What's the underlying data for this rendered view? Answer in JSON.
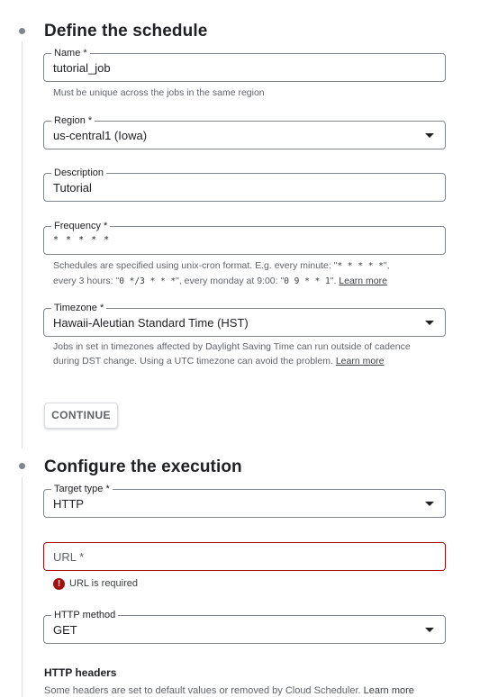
{
  "schedule": {
    "title": "Define the schedule",
    "name": {
      "label": "Name *",
      "value": "tutorial_job",
      "hint": "Must be unique across the jobs in the same region"
    },
    "region": {
      "label": "Region *",
      "value": "us-central1 (Iowa)"
    },
    "description": {
      "label": "Description",
      "value": "Tutorial"
    },
    "frequency": {
      "label": "Frequency *",
      "value": "* * * * *",
      "hint_1": "Schedules are specified using unix-cron format. E.g. every minute: \"",
      "hint_code_1": "* * * * *",
      "hint_2": "\",",
      "hint_3": "every 3 hours: \"",
      "hint_code_2": "0 */3 * * *",
      "hint_4": "\", every monday at 9:00: \"",
      "hint_code_3": "0 9 * * 1",
      "hint_5": "\". ",
      "learn_more": "Learn more"
    },
    "timezone": {
      "label": "Timezone *",
      "value": "Hawaii-Aleutian Standard Time (HST)",
      "hint": "Jobs in set in timezones affected by Daylight Saving Time can run outside of cadence during DST change. Using a UTC timezone can avoid the problem. ",
      "learn_more": "Learn more"
    },
    "continue_label": "CONTINUE"
  },
  "execution": {
    "title": "Configure the execution",
    "target_type": {
      "label": "Target type *",
      "value": "HTTP"
    },
    "url": {
      "placeholder": "URL *",
      "error": "URL is required",
      "error_icon": "!"
    },
    "http_method": {
      "label": "HTTP method",
      "value": "GET"
    },
    "headers": {
      "title": "HTTP headers",
      "hint": "Some headers are set to default values or removed by Cloud Scheduler. ",
      "learn_more": "Learn more"
    }
  },
  "colors": {
    "error": "#a50e0e",
    "border": "#80868b",
    "muted": "#5f6368"
  }
}
